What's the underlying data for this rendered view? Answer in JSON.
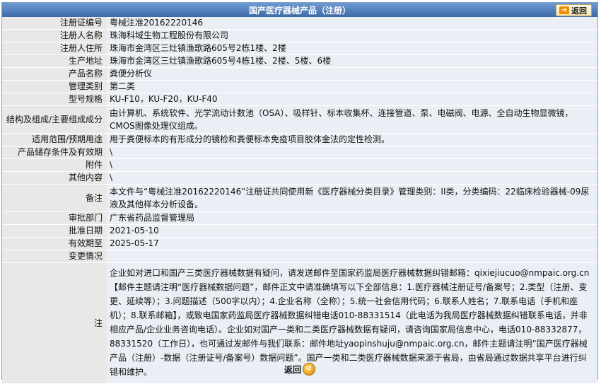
{
  "header": {
    "title": "国产医疗器械产品（注册）",
    "back_label": "返回"
  },
  "rows": [
    {
      "label": "注册证编号",
      "value": "粤械注准20162220146"
    },
    {
      "label": "注册人名称",
      "value": "珠海科域生物工程股份有限公司"
    },
    {
      "label": "注册人住所",
      "value": "珠海市金湾区三灶镇渔歌路605号2栋1楼、2楼"
    },
    {
      "label": "生产地址",
      "value": "珠海市金湾区三灶镇渔歌路605号4栋1楼、2楼、5楼、6楼"
    },
    {
      "label": "产品名称",
      "value": "粪便分析仪"
    },
    {
      "label": "管理类别",
      "value": "第二类"
    },
    {
      "label": "型号规格",
      "value": "KU-F10，KU-F20，KU-F40"
    },
    {
      "label": "结构及组成/主要组成成分",
      "value": "由计算机、系统软件、光学流动计数池（OSA）、吸样针、标本收集杯、连接管道、泵、电磁阀、电源、全自动生物显微镜，CMOS图像处理仪组成。"
    },
    {
      "label": "适用范围/预期用途",
      "value": "用于粪便标本的有形成分的镜检和粪便标本免疫项目胶体金法的定性检测。"
    },
    {
      "label": "产品储存条件及有效期",
      "value": "\\"
    },
    {
      "label": "附件",
      "value": "\\"
    },
    {
      "label": "其他内容",
      "value": "\\"
    },
    {
      "label": "备注",
      "value": "本文件与“粤械注准20162220146”注册证共同使用新《医疗器械分类目录》管理类别：II类，分类编码：22临床检验器械-09尿液及其他样本分析设备。"
    },
    {
      "label": "审批部门",
      "value": "广东省药品监督管理局"
    },
    {
      "label": "批准日期",
      "value": "2021-05-10"
    },
    {
      "label": "有效期至",
      "value": "2025-05-17"
    },
    {
      "label": "变更情况",
      "value": ""
    }
  ],
  "note": {
    "label": "注",
    "text": "企业如对进口和国产三类医疗器械数据有疑问，请发送邮件至国家药监局医疗器械数据纠错邮箱：qixiejiucuo@nmpaic.org.cn【邮件主题请注明“医疗器械数据问题”，邮件正文中请准确填写以下全部信息：1.医疗器械注册证号/备案号；2.类型（注册、变更、延续等）；3.问题描述（500字以内）；4.企业名称（全称）；5.统一社会信用代码；6.联系人姓名；7.联系电话（手机和座机）；8.联系邮箱】，或致电国家药监局医疗器械数据纠错电话010-88331514（此电话为我局医疗器械数据纠错联系电话，并非相应产品/企业业务咨询电话）。企业如对国产一类和二类医疗器械数据有疑问，请咨询国家局信息中心，电话010-88332877，88331520（工作日），也可通过发邮件与我们联系：邮件地址yaopinshuju@nmpaic.org.cn，邮件主题请注明“国产医疗器械产品（注册）-数据（注册证号/备案号）数据问题”。国产一类和二类医疗器械数据来源于省局，由省局通过数据共享平台进行纠错和维护。"
  },
  "footer": {
    "back_label": "返回"
  }
}
